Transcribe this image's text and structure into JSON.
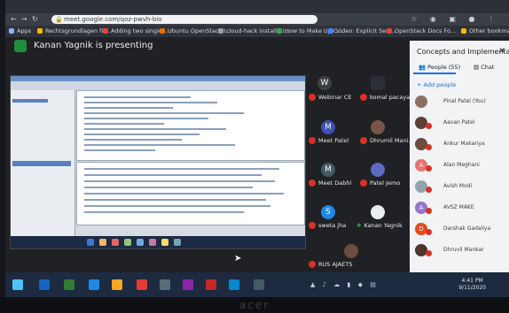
{
  "browser": {
    "url": "meet.google.com/qoz-pwvh-bio",
    "bookmarks": [
      "Apps",
      "Rechtsgrundlagen fü...",
      "Adding two single...",
      "Ubuntu OpenStack I...",
      "cloud-hack installati...",
      "How to Make Up C...",
      "Video: Explicit Serv...",
      "OpenStack Docs Fo...",
      "Other bookmarks"
    ]
  },
  "meet": {
    "presenting_text": "Kanan Yagnik is presenting"
  },
  "tiles": [
    {
      "initial": "W",
      "name": "Webinar CE"
    },
    {
      "initial": "",
      "name": "komal pacaya"
    },
    {
      "initial": "M",
      "name": "Meet Patel"
    },
    {
      "initial": "",
      "name": "Dhrumil Mani..."
    },
    {
      "initial": "M",
      "name": "Meet Dabhi"
    },
    {
      "initial": "",
      "name": "Patel Jemo"
    },
    {
      "initial": "S",
      "name": "sweta jha"
    },
    {
      "initial": "",
      "name": "Kanan Yagnik"
    },
    {
      "initial": "",
      "name": "RUS AJAETS"
    }
  ],
  "panel": {
    "title": "Concepts and Implementati...",
    "close": "✕",
    "tab_people": "People (55)",
    "tab_chat": "Chat",
    "add_people": "Add people",
    "people": [
      {
        "initial": "",
        "name": "Pinal Patel (You)",
        "color": "#8d6e63"
      },
      {
        "initial": "",
        "name": "Aavan Patel",
        "color": "#5d4037"
      },
      {
        "initial": "",
        "name": "Ankur Makariya",
        "color": "#6d4c41"
      },
      {
        "initial": "A",
        "name": "Alan Meghani",
        "color": "#e57373"
      },
      {
        "initial": "",
        "name": "Avish Modi",
        "color": "#90a4ae"
      },
      {
        "initial": "A",
        "name": "AVSZ MAKE",
        "color": "#9575cd"
      },
      {
        "initial": "D",
        "name": "Darshak Gadaliya",
        "color": "#e64a19"
      },
      {
        "initial": "",
        "name": "Dhruvil Mankar",
        "color": "#4e342e"
      }
    ]
  },
  "taskbar": {
    "time": "4:41 PM",
    "date": "9/11/2020"
  },
  "bezel_brand": "acer",
  "colors": {
    "meet_bg": "#202124",
    "panel_bg": "#f1f3f4",
    "mute_red": "#d93025",
    "accent_blue": "#1a73e8"
  }
}
